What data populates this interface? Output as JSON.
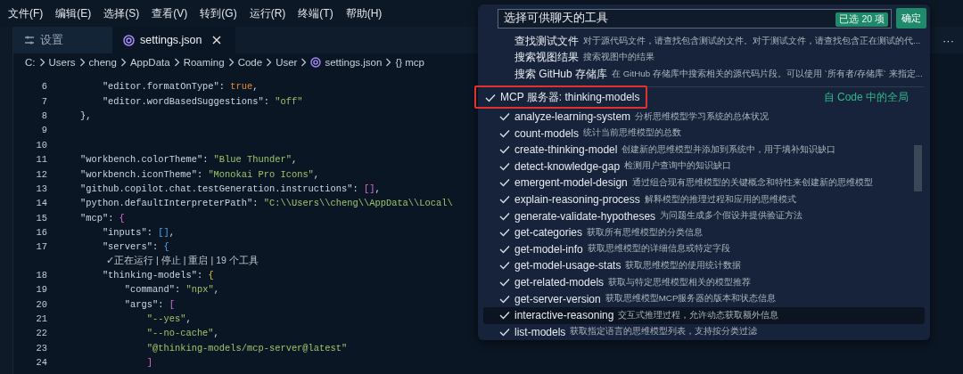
{
  "menu_bar": [
    "文件(F)",
    "编辑(E)",
    "选择(S)",
    "查看(V)",
    "转到(G)",
    "运行(R)",
    "终端(T)",
    "帮助(H)"
  ],
  "tabs": [
    {
      "label": "设置",
      "kind": "settings",
      "selected": false,
      "closable": false
    },
    {
      "label": "settings.json",
      "kind": "file",
      "selected": true,
      "closable": true
    }
  ],
  "tab_actions": "···",
  "breadcrumb": [
    {
      "label": "C:",
      "kind": "text"
    },
    {
      "label": "Users",
      "kind": "text"
    },
    {
      "label": "cheng",
      "kind": "text"
    },
    {
      "label": "AppData",
      "kind": "text"
    },
    {
      "label": "Roaming",
      "kind": "text"
    },
    {
      "label": "Code",
      "kind": "text"
    },
    {
      "label": "User",
      "kind": "text"
    },
    {
      "label": "settings.json",
      "kind": "file"
    },
    {
      "label": "{} mcp",
      "kind": "text"
    }
  ],
  "editor": {
    "lines": [
      {
        "kind": "code",
        "number": "6",
        "tokens": [
          {
            "t": "        \"editor.formatOnType\"",
            "kind": "key"
          },
          {
            "t": ": ",
            "kind": "punct"
          },
          {
            "t": "true",
            "kind": "bool"
          },
          {
            "t": ",",
            "kind": "punct"
          }
        ]
      },
      {
        "kind": "code",
        "number": "7",
        "tokens": [
          {
            "t": "        \"editor.wordBasedSuggestions\"",
            "kind": "key"
          },
          {
            "t": ": ",
            "kind": "punct"
          },
          {
            "t": "\"off\"",
            "kind": "string"
          }
        ]
      },
      {
        "kind": "code",
        "number": "8",
        "tokens": [
          {
            "t": "    },",
            "kind": "punct"
          }
        ]
      },
      {
        "kind": "blank",
        "number": "9"
      },
      {
        "kind": "blank",
        "number": "10"
      },
      {
        "kind": "code",
        "number": "11",
        "tokens": [
          {
            "t": "    \"workbench.colorTheme\"",
            "kind": "key"
          },
          {
            "t": ": ",
            "kind": "punct"
          },
          {
            "t": "\"Blue Thunder\"",
            "kind": "string"
          },
          {
            "t": ",",
            "kind": "punct"
          }
        ]
      },
      {
        "kind": "code",
        "number": "12",
        "tokens": [
          {
            "t": "    \"workbench.iconTheme\"",
            "kind": "key"
          },
          {
            "t": ": ",
            "kind": "punct"
          },
          {
            "t": "\"Monokai Pro Icons\"",
            "kind": "string"
          },
          {
            "t": ",",
            "kind": "punct"
          }
        ]
      },
      {
        "kind": "code",
        "number": "13",
        "tokens": [
          {
            "t": "    \"github.copilot.chat.testGeneration.instructions\"",
            "kind": "key"
          },
          {
            "t": ": ",
            "kind": "punct"
          },
          {
            "t": "[]",
            "kind": "pink"
          },
          {
            "t": ",",
            "kind": "punct"
          }
        ]
      },
      {
        "kind": "code",
        "number": "14",
        "tokens": [
          {
            "t": "    \"python.defaultInterpreterPath\"",
            "kind": "key"
          },
          {
            "t": ": ",
            "kind": "punct"
          },
          {
            "t": "\"C:\\\\Users\\\\cheng\\\\AppData\\\\Local\\",
            "kind": "string"
          }
        ]
      },
      {
        "kind": "code",
        "number": "15",
        "tokens": [
          {
            "t": "    \"mcp\"",
            "kind": "key"
          },
          {
            "t": ": ",
            "kind": "punct"
          },
          {
            "t": "{",
            "kind": "pink"
          }
        ]
      },
      {
        "kind": "code",
        "number": "16",
        "tokens": [
          {
            "t": "        \"inputs\"",
            "kind": "key"
          },
          {
            "t": ": ",
            "kind": "punct"
          },
          {
            "t": "[]",
            "kind": "blue"
          },
          {
            "t": ",",
            "kind": "punct"
          }
        ]
      },
      {
        "kind": "code",
        "number": "17",
        "tokens": [
          {
            "t": "        \"servers\"",
            "kind": "key"
          },
          {
            "t": ": ",
            "kind": "punct"
          },
          {
            "t": "{",
            "kind": "blue"
          }
        ]
      },
      {
        "kind": "lens",
        "actions": [
          "✓正在运行",
          "停止",
          "重启",
          "19 个工具"
        ],
        "separator": "|"
      },
      {
        "kind": "code",
        "number": "18",
        "tokens": [
          {
            "t": "        \"thinking-models\"",
            "kind": "key"
          },
          {
            "t": ": ",
            "kind": "punct"
          },
          {
            "t": "{",
            "kind": "gold"
          }
        ]
      },
      {
        "kind": "code",
        "number": "19",
        "tokens": [
          {
            "t": "            \"command\"",
            "kind": "key"
          },
          {
            "t": ": ",
            "kind": "punct"
          },
          {
            "t": "\"npx\"",
            "kind": "string"
          },
          {
            "t": ",",
            "kind": "punct"
          }
        ]
      },
      {
        "kind": "code",
        "number": "20",
        "tokens": [
          {
            "t": "            \"args\"",
            "kind": "key"
          },
          {
            "t": ": ",
            "kind": "punct"
          },
          {
            "t": "[",
            "kind": "pink"
          }
        ]
      },
      {
        "kind": "code",
        "number": "21",
        "tokens": [
          {
            "t": "                \"--yes\"",
            "kind": "string"
          },
          {
            "t": ",",
            "kind": "punct"
          }
        ]
      },
      {
        "kind": "code",
        "number": "22",
        "tokens": [
          {
            "t": "                \"--no-cache\"",
            "kind": "string"
          },
          {
            "t": ",",
            "kind": "punct"
          }
        ]
      },
      {
        "kind": "code",
        "number": "23",
        "tokens": [
          {
            "t": "                \"@thinking-models/mcp-server@latest\"",
            "kind": "string"
          }
        ]
      },
      {
        "kind": "code",
        "number": "24",
        "tokens": [
          {
            "t": "                ]",
            "kind": "pink"
          }
        ]
      }
    ]
  },
  "quick_pick": {
    "input": {
      "value": "选择可供聊天的工具"
    },
    "badge": "已选 20 项",
    "ok_button": "确定",
    "items": [
      {
        "kind": "tool",
        "name": "查找测试文件",
        "description": "对于源代码文件，请查找包含测试的文件。对于测试文件，请查找包含正在测试的代...",
        "checked": false,
        "selected": false
      },
      {
        "kind": "tool",
        "name": "搜索视图结果",
        "description": "搜索视图中的结果",
        "checked": false,
        "selected": false
      },
      {
        "kind": "tool",
        "name": "搜索 GitHub 存储库",
        "description": "在 GitHub 存储库中搜索相关的源代码片段。可以使用 `所有者/存储库` 来指定...",
        "checked": false,
        "selected": false
      },
      {
        "kind": "group",
        "name": "MCP 服务器: thinking-models",
        "detail": "自 Code 中的全局",
        "checked": true,
        "selected": false
      },
      {
        "kind": "tool",
        "name": "analyze-learning-system",
        "description": "分析思维模型学习系统的总体状况",
        "checked": true,
        "selected": false
      },
      {
        "kind": "tool",
        "name": "count-models",
        "description": "统计当前思维模型的总数",
        "checked": true,
        "selected": false
      },
      {
        "kind": "tool",
        "name": "create-thinking-model",
        "description": "创建新的思维模型并添加到系统中，用于填补知识缺口",
        "checked": true,
        "selected": false
      },
      {
        "kind": "tool",
        "name": "detect-knowledge-gap",
        "description": "检测用户查询中的知识缺口",
        "checked": true,
        "selected": false
      },
      {
        "kind": "tool",
        "name": "emergent-model-design",
        "description": "通过组合现有思维模型的关键概念和特性来创建新的思维模型",
        "checked": true,
        "selected": false
      },
      {
        "kind": "tool",
        "name": "explain-reasoning-process",
        "description": "解释模型的推理过程和应用的思维模式",
        "checked": true,
        "selected": false
      },
      {
        "kind": "tool",
        "name": "generate-validate-hypotheses",
        "description": "为问题生成多个假设并提供验证方法",
        "checked": true,
        "selected": false
      },
      {
        "kind": "tool",
        "name": "get-categories",
        "description": "获取所有思维模型的分类信息",
        "checked": true,
        "selected": false
      },
      {
        "kind": "tool",
        "name": "get-model-info",
        "description": "获取思维模型的详细信息或特定字段",
        "checked": true,
        "selected": false
      },
      {
        "kind": "tool",
        "name": "get-model-usage-stats",
        "description": "获取思维模型的使用统计数据",
        "checked": true,
        "selected": false
      },
      {
        "kind": "tool",
        "name": "get-related-models",
        "description": "获取与特定思维模型相关的模型推荐",
        "checked": true,
        "selected": false
      },
      {
        "kind": "tool",
        "name": "get-server-version",
        "description": "获取思维模型MCP服务器的版本和状态信息",
        "checked": true,
        "selected": false
      },
      {
        "kind": "tool",
        "name": "interactive-reasoning",
        "description": "交互式推理过程，允许动态获取额外信息",
        "checked": true,
        "selected": true
      },
      {
        "kind": "tool",
        "name": "list-models",
        "description": "获取指定语言的思维模型列表，支持按分类过滤",
        "checked": true,
        "selected": false
      }
    ]
  }
}
